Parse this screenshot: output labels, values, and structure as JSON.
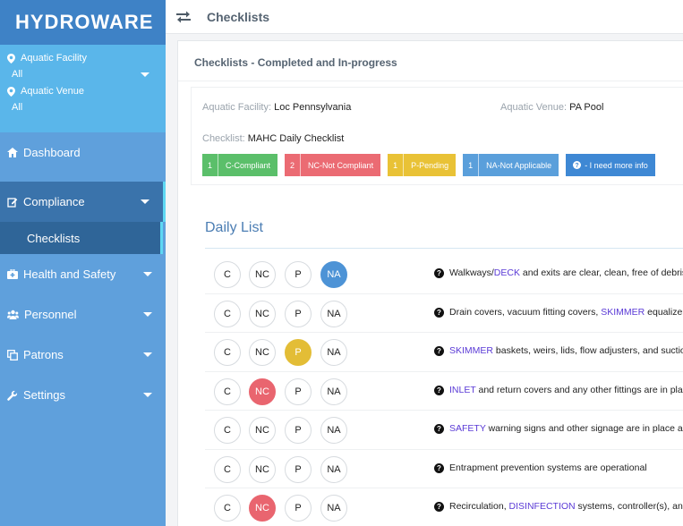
{
  "app": {
    "logo": "HYDROWARE"
  },
  "sidebar": {
    "facility_label": "Aquatic Facility",
    "facility_value": "All",
    "venue_label": "Aquatic Venue",
    "venue_value": "All",
    "items": [
      {
        "label": "Dashboard"
      },
      {
        "label": "Compliance"
      },
      {
        "label": "Checklists"
      },
      {
        "label": "Health and Safety"
      },
      {
        "label": "Personnel"
      },
      {
        "label": "Patrons"
      },
      {
        "label": "Settings"
      }
    ]
  },
  "topbar": {
    "title": "Checklists"
  },
  "panel": {
    "title": "Checklists - Completed and In-progress",
    "facility_key": "Aquatic Facility:",
    "facility_val": "Loc Pennsylvania",
    "venue_key": "Aquatic Venue:",
    "venue_val": "PA Pool",
    "checklist_key": "Checklist:",
    "checklist_val": "MAHC Daily Checklist",
    "badges": [
      {
        "count": "1",
        "text": "C-Compliant"
      },
      {
        "count": "2",
        "text": "NC-Not Compliant"
      },
      {
        "count": "1",
        "text": "P-Pending"
      },
      {
        "count": "1",
        "text": "NA-Not Applicable"
      },
      {
        "text": "- I need more info"
      }
    ]
  },
  "daily": {
    "title": "Daily List",
    "buttons": {
      "c": "C",
      "nc": "NC",
      "p": "P",
      "na": "NA"
    },
    "rows": [
      {
        "selected": "NA",
        "kw": "DECK",
        "pre": "Walkways/",
        "post": " and exits are clear, clean, free of debris"
      },
      {
        "selected": "",
        "kw": "SKIMMER",
        "pre": "Drain covers, vacuum fitting covers, ",
        "post": " equalizer c"
      },
      {
        "selected": "P",
        "kw": "SKIMMER",
        "pre": "",
        "post": " baskets, weirs, lids, flow adjusters, and suction"
      },
      {
        "selected": "NC",
        "kw": "INLET",
        "pre": "",
        "post": " and return covers and any other fittings are in place"
      },
      {
        "selected": "",
        "kw": "SAFETY",
        "pre": "",
        "post": " warning signs and other signage are in place and"
      },
      {
        "selected": "",
        "kw": "",
        "pre": "Entrapment prevention systems are operational",
        "post": ""
      },
      {
        "selected": "NC",
        "kw": "DISINFECTION",
        "pre": "Recirculation, ",
        "post": " systems, controller(s), and p"
      }
    ]
  },
  "colors": {
    "sidebar": "#5fa0dc",
    "accent": "#4d93d6",
    "pending": "#e3bd36",
    "noncompliant": "#e9656f",
    "compliant": "#5bbf6a",
    "keyword": "#5a3ad6"
  }
}
